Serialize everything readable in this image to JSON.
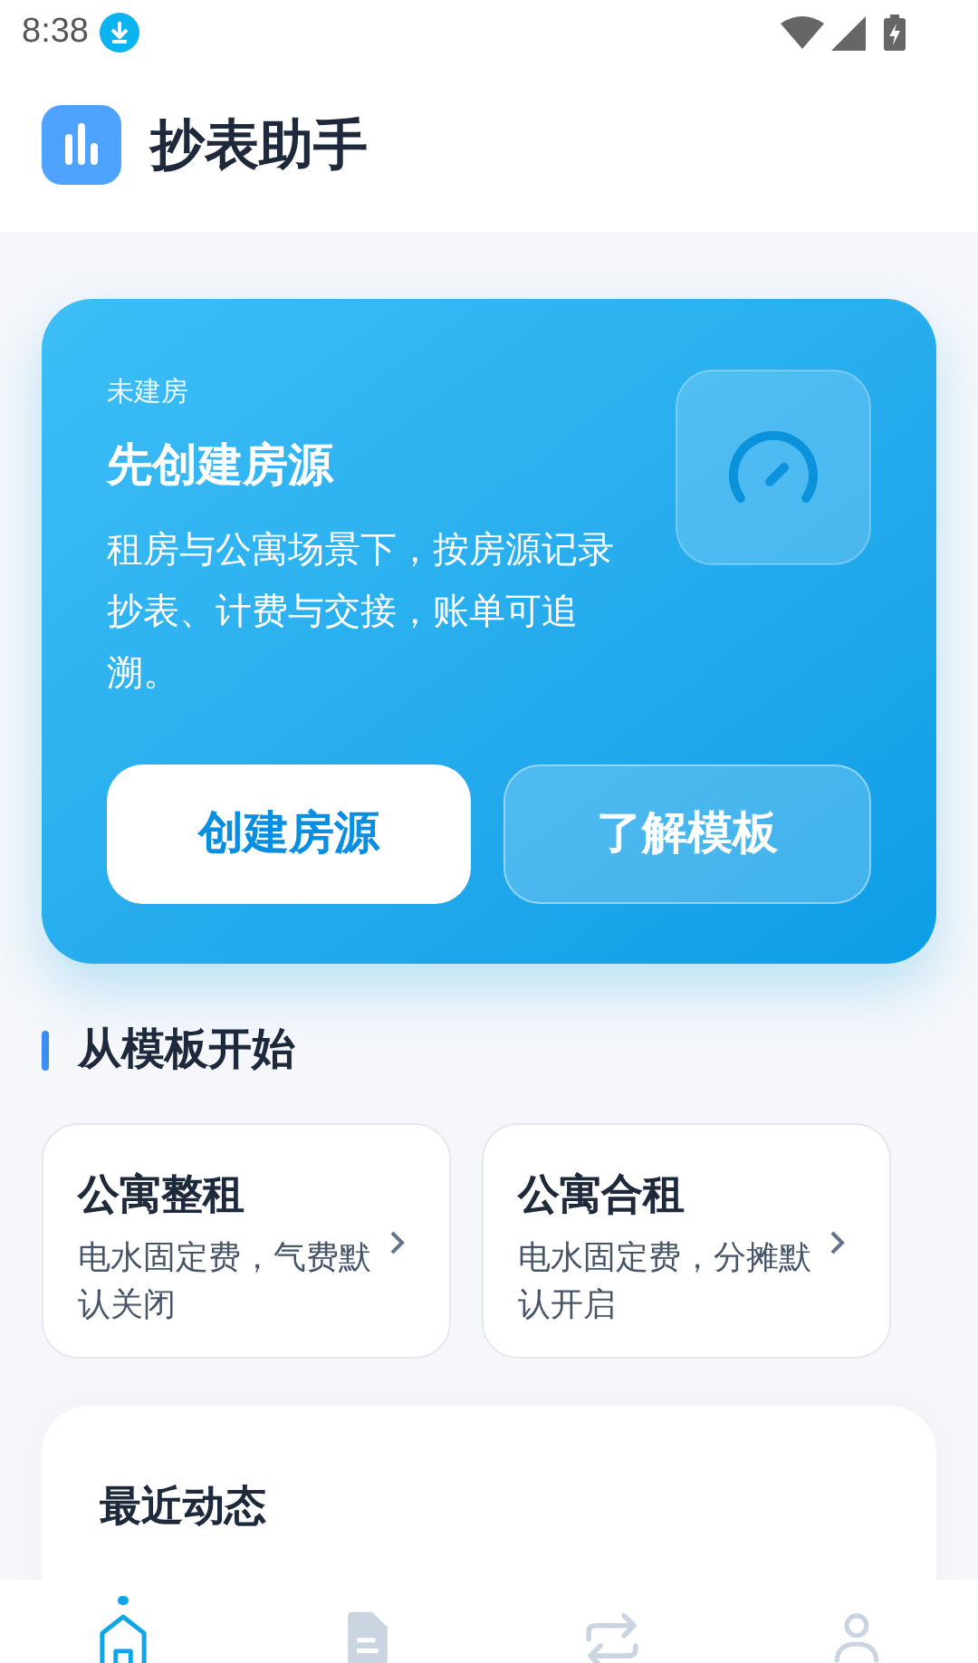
{
  "status_bar": {
    "time": "8:38"
  },
  "app": {
    "title": "抄表助手"
  },
  "hero": {
    "eyebrow": "未建房",
    "title": "先创建房源",
    "description": "租房与公寓场景下，按房源记录抄表、计费与交接，账单可追溯。",
    "buttons": [
      {
        "label": "创建房源",
        "kind": "primary"
      },
      {
        "label": "了解模板",
        "kind": "secondary"
      }
    ]
  },
  "templates_section": {
    "title": "从模板开始"
  },
  "templates": [
    {
      "title": "公寓整租",
      "description": "电水固定费，气费默认关闭"
    },
    {
      "title": "公寓合租",
      "description": "电水固定费，分摊默认开启"
    }
  ],
  "recent": {
    "title": "最近动态"
  },
  "bottom_nav": [
    {
      "kind": "home",
      "selected": true
    },
    {
      "kind": "bills",
      "selected": false
    },
    {
      "kind": "transfer",
      "selected": false
    },
    {
      "kind": "profile",
      "selected": false
    }
  ]
}
